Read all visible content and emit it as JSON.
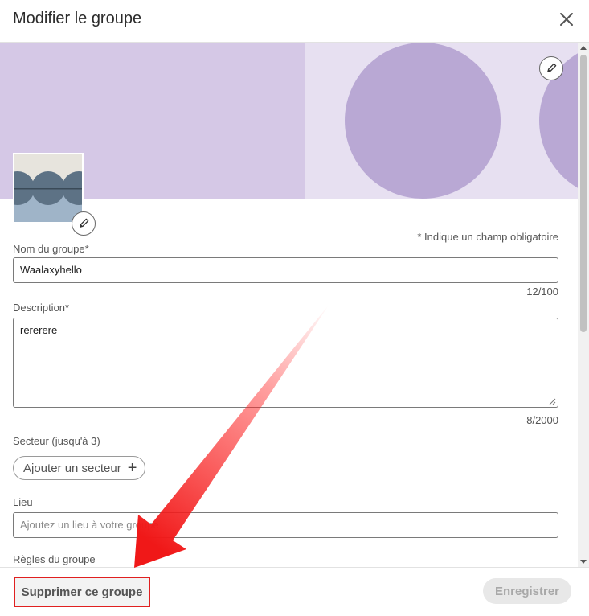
{
  "dialog": {
    "title": "Modifier le groupe",
    "close_icon": "close-icon"
  },
  "form": {
    "required_note": "* Indique un champ obligatoire",
    "name": {
      "label": "Nom du groupe*",
      "value": "Waalaxyhello",
      "counter": "12/100"
    },
    "description": {
      "label": "Description*",
      "value": "rererere",
      "counter": "8/2000"
    },
    "sector": {
      "label": "Secteur (jusqu'à 3)",
      "button_label": "Ajouter un secteur",
      "button_icon": "plus-icon"
    },
    "location": {
      "label": "Lieu",
      "placeholder": "Ajoutez un lieu à votre groupe"
    },
    "rules": {
      "label": "Règles du groupe"
    }
  },
  "footer": {
    "delete_label": "Supprimer ce groupe",
    "save_label": "Enregistrer"
  },
  "colors": {
    "banner_background": "#d5c8e6",
    "banner_circles": "#b9a8d4",
    "highlight": "#e02020"
  }
}
